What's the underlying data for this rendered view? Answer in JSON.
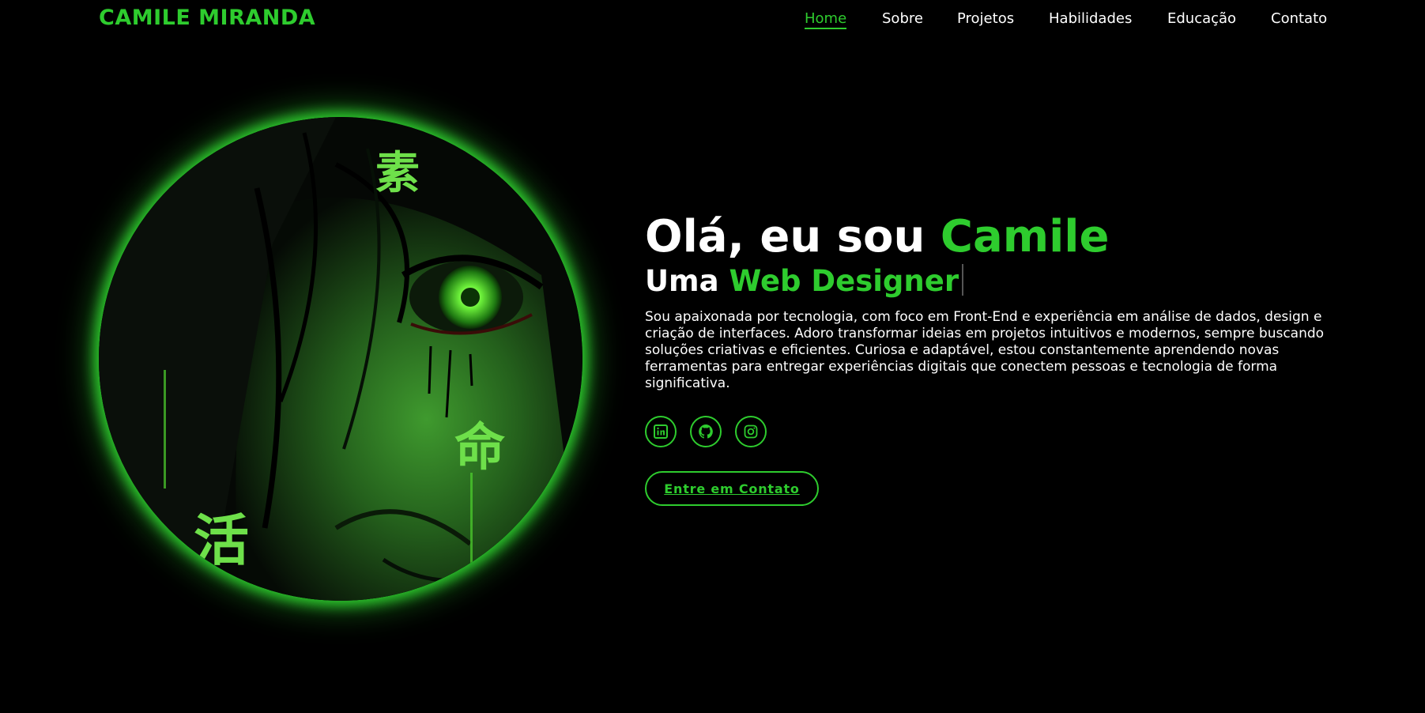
{
  "header": {
    "logo": "CAMILE MIRANDA",
    "nav": [
      {
        "label": "Home",
        "active": true
      },
      {
        "label": "Sobre"
      },
      {
        "label": "Projetos"
      },
      {
        "label": "Habilidades"
      },
      {
        "label": "Educação"
      },
      {
        "label": "Contato"
      }
    ]
  },
  "hero": {
    "greeting_prefix": "Olá, eu sou",
    "greeting_name": "Camile",
    "role_prefix": "Uma",
    "role_highlight": "Web Designer",
    "description": "Sou apaixonada por tecnologia, com foco em Front-End e experiência em análise de dados, design e criação de interfaces. Adoro transformar ideias em projetos intuitivos e modernos, sempre buscando soluções criativas e eficientes. Curiosa e adaptável, estou constantemente aprendendo novas ferramentas para entregar experiências digitais que conectem pessoas e tecnologia de forma significativa.",
    "socials": [
      {
        "icon": "linkedin-icon"
      },
      {
        "icon": "github-icon"
      },
      {
        "icon": "instagram-icon"
      }
    ],
    "cta_label": "Entre em Contato"
  },
  "colors": {
    "accent": "#2ecc2e",
    "background": "#000000",
    "text": "#ffffff"
  }
}
